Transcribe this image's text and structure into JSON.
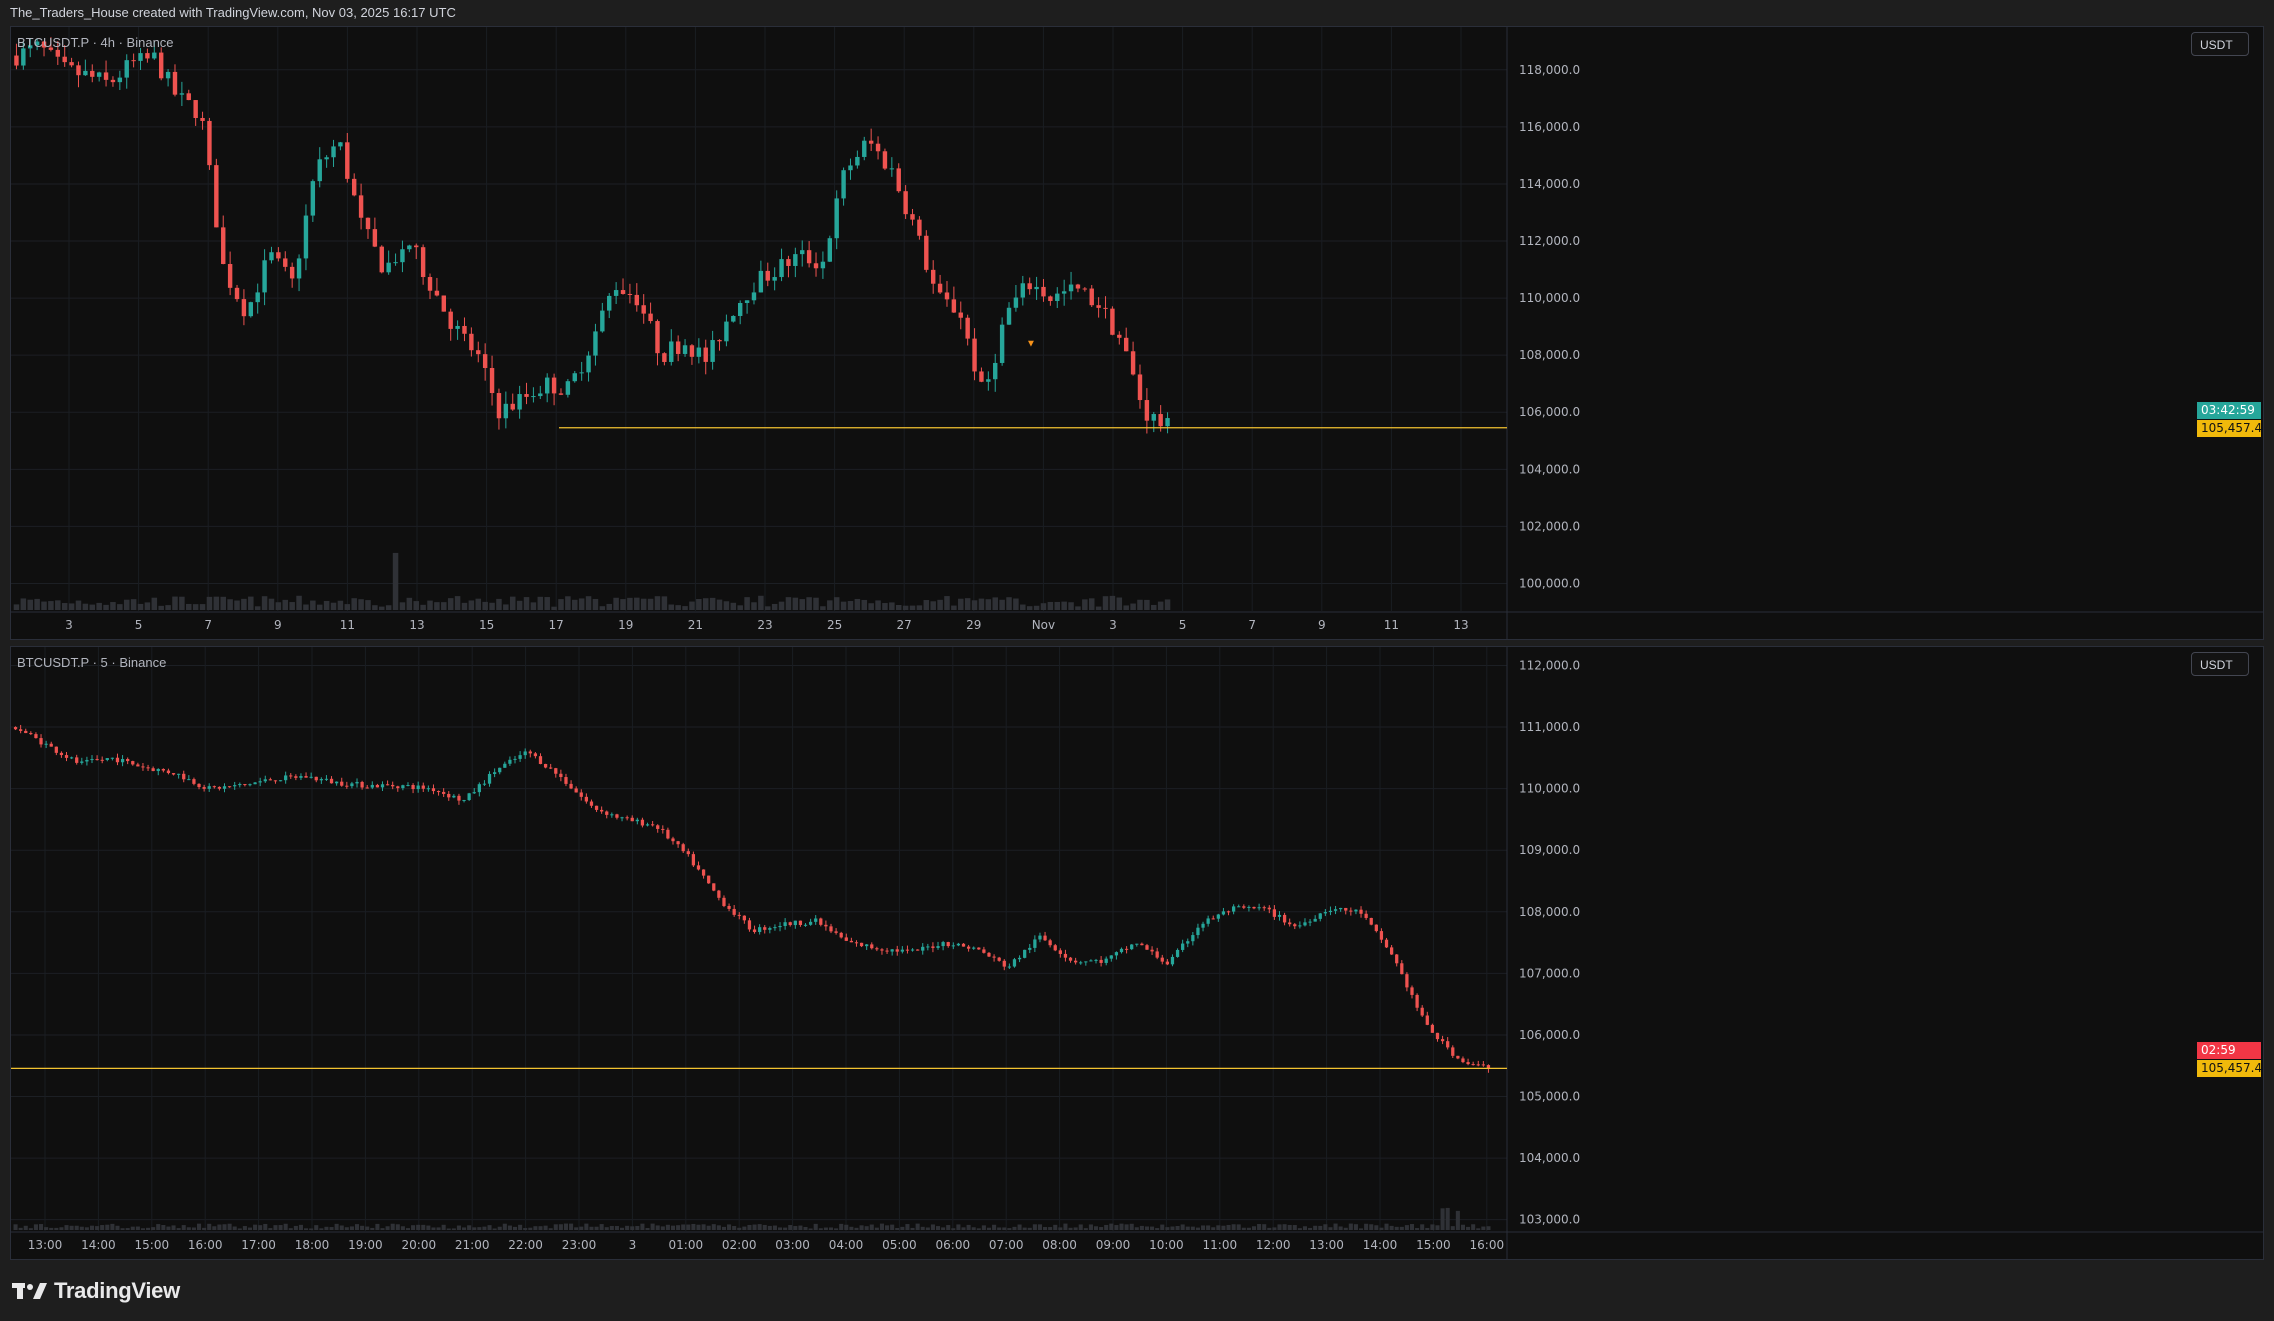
{
  "header": {
    "credit": "The_Traders_House created with TradingView.com, Nov 03, 2025 16:17 UTC"
  },
  "colors": {
    "up": "#26a69a",
    "down": "#ef5350",
    "level_line": "#f2c230",
    "price_tag_green": "#26a69a",
    "price_tag_red": "#f23645",
    "level_tag": "#f0b90b"
  },
  "pane_top": {
    "title": "BTCUSDT.P · 4h · Binance",
    "unit": "USDT",
    "y_ticks": [
      "118,000.0",
      "116,000.0",
      "114,000.0",
      "112,000.0",
      "110,000.0",
      "108,000.0",
      "106,000.0",
      "104,000.0",
      "102,000.0",
      "100,000.0"
    ],
    "x_ticks": [
      "3",
      "5",
      "7",
      "9",
      "11",
      "13",
      "15",
      "17",
      "19",
      "21",
      "23",
      "25",
      "27",
      "29",
      "Nov",
      "3",
      "5",
      "7",
      "9",
      "11",
      "13"
    ],
    "countdown": "03:42:59",
    "level_price": "105,457.4",
    "level_value": 105457.4,
    "marker": "▼"
  },
  "pane_bottom": {
    "title": "BTCUSDT.P · 5 · Binance",
    "unit": "USDT",
    "y_ticks": [
      "112,000.0",
      "111,000.0",
      "110,000.0",
      "109,000.0",
      "108,000.0",
      "107,000.0",
      "106,000.0",
      "105,000.0",
      "104,000.0",
      "103,000.0"
    ],
    "x_ticks": [
      "13:00",
      "14:00",
      "15:00",
      "16:00",
      "17:00",
      "18:00",
      "19:00",
      "20:00",
      "21:00",
      "22:00",
      "23:00",
      "3",
      "01:00",
      "02:00",
      "03:00",
      "04:00",
      "05:00",
      "06:00",
      "07:00",
      "08:00",
      "09:00",
      "10:00",
      "11:00",
      "12:00",
      "13:00",
      "14:00",
      "15:00",
      "16:00"
    ],
    "countdown": "02:59",
    "level_price": "105,457.4",
    "level_value": 105457.4
  },
  "chart_data": [
    {
      "type": "candlestick",
      "title": "BTCUSDT.P · 4h · Binance",
      "ylim": [
        99000,
        119500
      ],
      "x_labels": [
        "3",
        "5",
        "7",
        "9",
        "11",
        "13",
        "15",
        "17",
        "19",
        "21",
        "23",
        "25",
        "27",
        "29",
        "Nov",
        "3"
      ],
      "close_path": [
        118500,
        118800,
        118000,
        117800,
        117500,
        118200,
        118400,
        117000,
        116500,
        111000,
        109500,
        111500,
        110500,
        114500,
        115500,
        112500,
        111000,
        112000,
        110500,
        109000,
        108000,
        106000,
        106500,
        107000,
        106800,
        108500,
        110500,
        110000,
        108000,
        108500,
        107800,
        109500,
        110500,
        111000,
        111500,
        111200,
        114500,
        115500,
        114500,
        112500,
        110000,
        109500,
        106500,
        109500,
        110500,
        110000,
        110300,
        109800,
        108500,
        106000,
        105457.4
      ],
      "level": 105457.4
    },
    {
      "type": "candlestick",
      "title": "BTCUSDT.P · 5 · Binance",
      "ylim": [
        102800,
        112300
      ],
      "x_labels": [
        "13:00",
        "14:00",
        "15:00",
        "16:00",
        "17:00",
        "18:00",
        "19:00",
        "20:00",
        "21:00",
        "22:00",
        "23:00",
        "3",
        "01:00",
        "02:00",
        "03:00",
        "04:00",
        "05:00",
        "06:00",
        "07:00",
        "08:00",
        "09:00",
        "10:00",
        "11:00",
        "12:00",
        "13:00",
        "14:00",
        "15:00",
        "16:00"
      ],
      "close_path": [
        111000,
        110700,
        110400,
        110500,
        110350,
        110250,
        110000,
        110050,
        110150,
        110200,
        110100,
        110050,
        110050,
        110000,
        109800,
        110300,
        110600,
        110200,
        109700,
        109500,
        109400,
        108900,
        108200,
        107700,
        107800,
        107850,
        107500,
        107400,
        107350,
        107500,
        107400,
        107100,
        107600,
        107200,
        107200,
        107500,
        107150,
        107800,
        108050,
        108050,
        107750,
        108050,
        108000,
        107300,
        106200,
        105600,
        105457.4
      ],
      "level": 105457.4
    }
  ]
}
